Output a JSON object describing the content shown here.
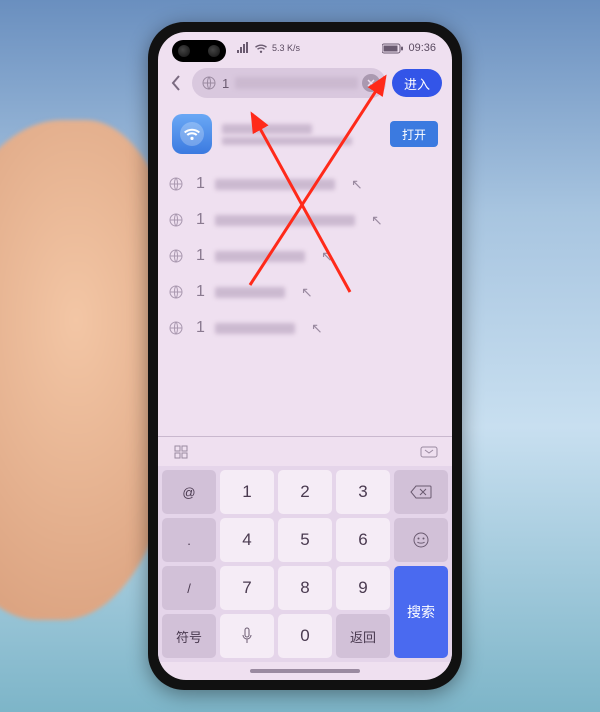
{
  "statusbar": {
    "signal_text": "5.3 K/s",
    "time": "09:36"
  },
  "address_bar": {
    "typed_prefix": "1",
    "enter_label": "进入"
  },
  "app_suggestion": {
    "open_label": "打开"
  },
  "suggestions": [
    {
      "prefix": "1"
    },
    {
      "prefix": "1"
    },
    {
      "prefix": "1"
    },
    {
      "prefix": "1"
    },
    {
      "prefix": "1"
    }
  ],
  "keyboard": {
    "at": "@",
    "rows": [
      [
        "1",
        "2",
        "3"
      ],
      [
        "4",
        "5",
        "6"
      ],
      [
        "7",
        "8",
        "9"
      ]
    ],
    "bottom_left": "符号",
    "zero": "0",
    "return_label": "返回",
    "search_label": "搜索"
  }
}
